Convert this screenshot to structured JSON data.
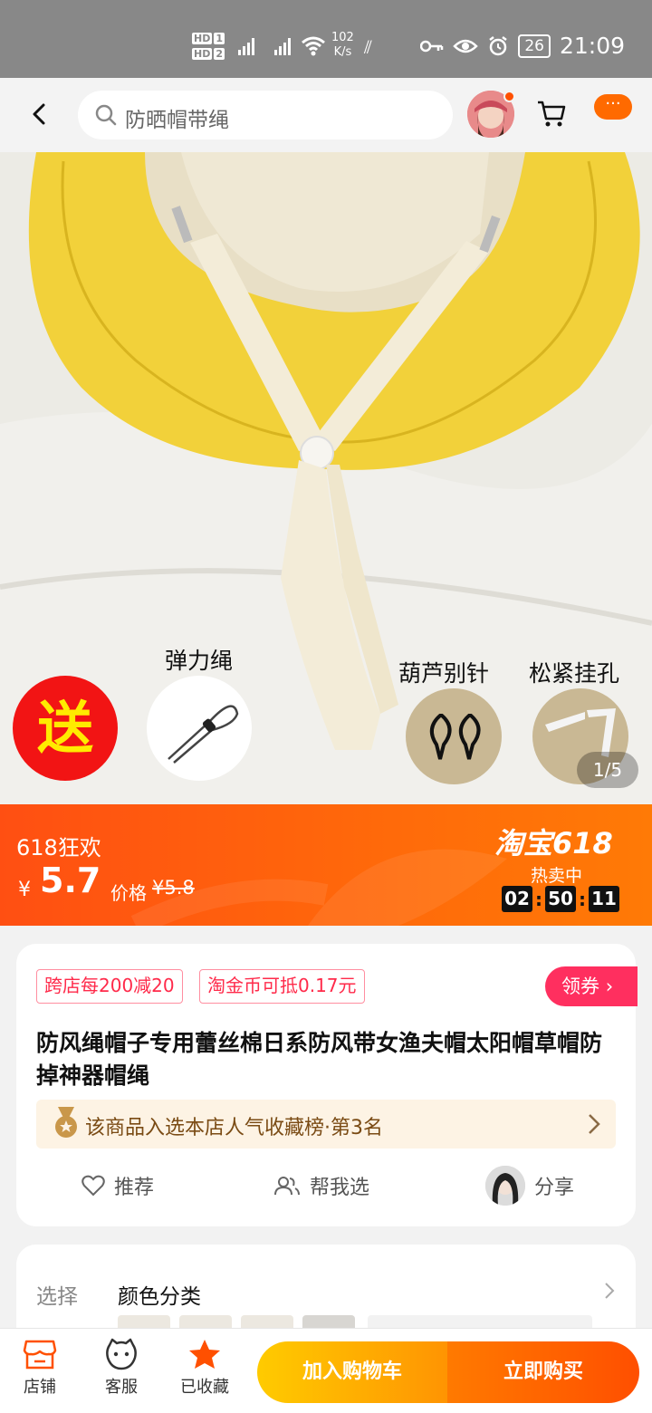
{
  "status_bar": {
    "hd1": "HD",
    "sim1": "1",
    "hd2": "HD",
    "sim2": "2",
    "net_speed_value": "102",
    "net_speed_unit": "K/s",
    "battery": "26",
    "time": "21:09"
  },
  "header": {
    "search_text": "防晒帽带绳",
    "more_label": "···"
  },
  "gallery": {
    "gift_song": "送",
    "gift_1_label": "弹力绳",
    "gift_2_label": "葫芦别针",
    "gift_3_label": "松紧挂孔",
    "page_indicator": "1/5"
  },
  "price_banner": {
    "promo_name": "618狂欢",
    "currency": "¥",
    "price": "5.7",
    "orig_label": "价格",
    "orig_price": "¥5.8",
    "brand": "淘宝618",
    "hot_label": "热卖中",
    "countdown": [
      "02",
      "50",
      "11"
    ],
    "countdown_sep": ":"
  },
  "info": {
    "tags": [
      "跨店每200减20",
      "淘金币可抵0.17元"
    ],
    "coupon_label": "领券",
    "title": "防风绳帽子专用蕾丝棉日系防风带女渔夫帽太阳帽草帽防掉神器帽绳",
    "rank_text": "该商品入选本店人气收藏榜·第3名",
    "actions": {
      "recommend": "推荐",
      "help_choose": "帮我选",
      "share": "分享"
    }
  },
  "select": {
    "label": "选择",
    "value": "颜色分类"
  },
  "bottom_nav": {
    "shop": "店铺",
    "service": "客服",
    "favorited": "已收藏",
    "add_to_cart": "加入购物车",
    "buy_now": "立即购买"
  },
  "colors": {
    "accent": "#ff5000",
    "brand_orange": "#ff6a00",
    "coupon_red": "#ff2f5f",
    "hat_yellow": "#f2d13a"
  }
}
